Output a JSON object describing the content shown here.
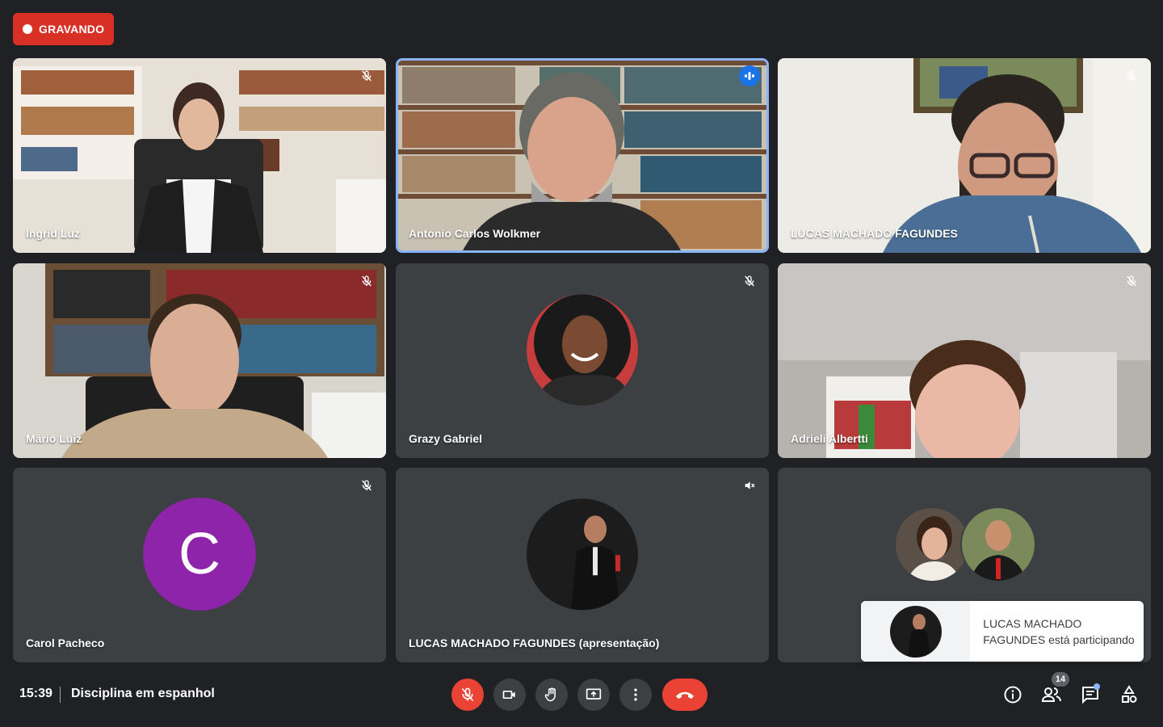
{
  "recording": {
    "label": "GRAVANDO"
  },
  "participants": [
    {
      "name": "Ingrid Luz"
    },
    {
      "name": "Antonio Carlos Wolkmer"
    },
    {
      "name": "LUCAS MACHADO FAGUNDES"
    },
    {
      "name": "Mário Luiz"
    },
    {
      "name": "Grazy Gabriel"
    },
    {
      "name": "Adrieli Albertti"
    },
    {
      "name": "Carol Pacheco",
      "initial": "C"
    },
    {
      "name": "LUCAS MACHADO FAGUNDES (apresentação)"
    }
  ],
  "toast": {
    "text": "LUCAS MACHADO FAGUNDES está participando"
  },
  "bottom": {
    "time": "15:39",
    "meeting_title": "Disciplina em espanhol",
    "people_count": "14"
  },
  "colors": {
    "accent": "#8ab4f8",
    "danger": "#ea4335",
    "recording": "#d93025",
    "tile": "#3c4043",
    "background": "#202124"
  },
  "icons": [
    "mic-off-icon",
    "speaking-icon",
    "camera-icon",
    "raise-hand-icon",
    "present-icon",
    "more-icon",
    "hangup-icon",
    "info-icon",
    "people-icon",
    "chat-icon",
    "activities-icon"
  ]
}
